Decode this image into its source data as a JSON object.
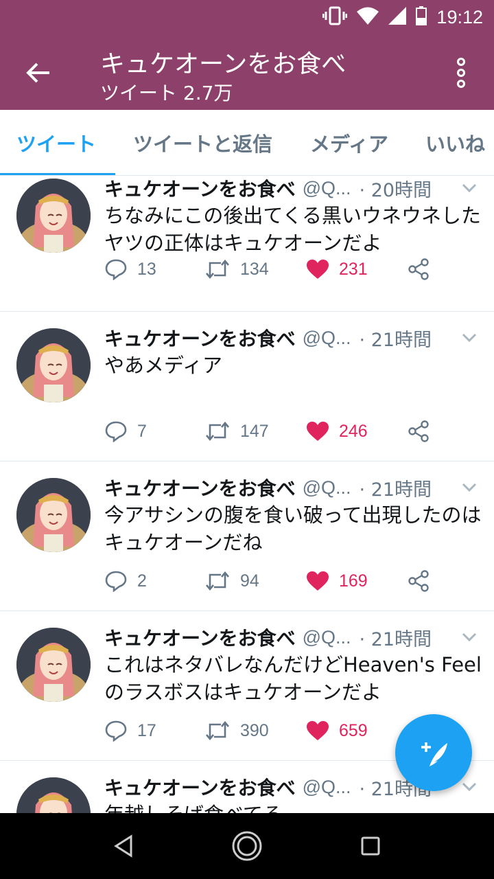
{
  "status": {
    "time": "19:12"
  },
  "header": {
    "title": "キュケオーンをお食べ",
    "subtitle": "ツイート 2.7万"
  },
  "tabs": [
    {
      "label": "ツイート",
      "active": true
    },
    {
      "label": "ツイートと返信",
      "active": false
    },
    {
      "label": "メディア",
      "active": false
    },
    {
      "label": "いいね",
      "active": false
    }
  ],
  "tweets": [
    {
      "name": "キュケオーンをお食べ",
      "handle": "@Q...",
      "time": "· 20時間",
      "text": "ちなみにこの後出てくる黒いウネウネしたヤツの正体はキュケオーンだよ",
      "replies": "13",
      "retweets": "134",
      "likes": "231"
    },
    {
      "name": "キュケオーンをお食べ",
      "handle": "@Q...",
      "time": "· 21時間",
      "text": "やあメディア",
      "replies": "7",
      "retweets": "147",
      "likes": "246"
    },
    {
      "name": "キュケオーンをお食べ",
      "handle": "@Q...",
      "time": "· 21時間",
      "text": "今アサシンの腹を食い破って出現したのはキュケオーンだね",
      "replies": "2",
      "retweets": "94",
      "likes": "169"
    },
    {
      "name": "キュケオーンをお食べ",
      "handle": "@Q...",
      "time": "· 21時間",
      "text": "これはネタバレなんだけどHeaven's Feelのラスボスはキュケオーンだよ",
      "replies": "17",
      "retweets": "390",
      "likes": "659"
    },
    {
      "name": "キュケオーンをお食べ",
      "handle": "@Q...",
      "time": "· 21時間",
      "text": "年越しそば食べてる",
      "replies": "",
      "retweets": "",
      "likes": ""
    }
  ],
  "colors": {
    "header": "#8d406a",
    "accent": "#1da1f2",
    "like": "#e0245e",
    "muted": "#657786"
  },
  "icons": {
    "back": "arrow-left-icon",
    "overflow": "more-vertical-icon",
    "compose": "compose-feather-icon",
    "reply": "reply-icon",
    "retweet": "retweet-icon",
    "like": "heart-icon",
    "share": "share-icon"
  }
}
